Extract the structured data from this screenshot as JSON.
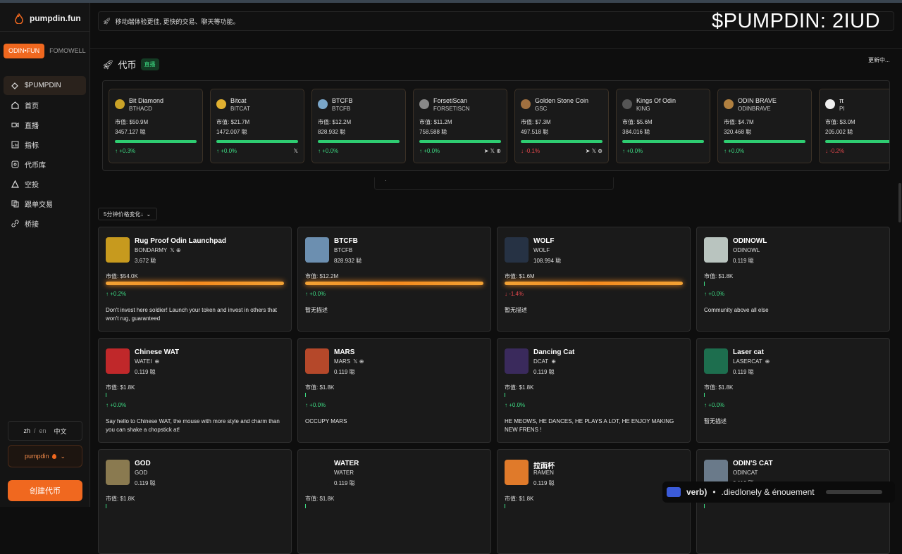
{
  "app": {
    "name": "pumpdin.fun"
  },
  "watermark": "$PUMPDIN: 2IUD",
  "banner": {
    "text": "移动端体验更佳, 更快的交易、聊天等功能。"
  },
  "platforms": [
    "ODIN•FUN",
    "FOMOWELL"
  ],
  "nav": [
    {
      "label": "$PUMPDIN",
      "icon": "diamond-icon"
    },
    {
      "label": "首页",
      "icon": "home-icon"
    },
    {
      "label": "直播",
      "icon": "video-icon"
    },
    {
      "label": "指标",
      "icon": "chart-icon"
    },
    {
      "label": "代币库",
      "icon": "library-icon"
    },
    {
      "label": "空投",
      "icon": "airdrop-icon"
    },
    {
      "label": "跟单交易",
      "icon": "copy-icon"
    },
    {
      "label": "桥接",
      "icon": "link-icon"
    }
  ],
  "lang": {
    "zh": "zh",
    "sep": "/",
    "en": "en",
    "native": "中文"
  },
  "account": {
    "name": "pumpdin"
  },
  "create_label": "创建代币",
  "section": {
    "title": "代币",
    "live": "直播",
    "updating": "更新中..."
  },
  "sort_label": "5分钟价格变化↓",
  "scroll_indicator": "·",
  "mini_tokens": [
    {
      "name": "Bit Diamond",
      "ticker": "BTHACD",
      "mcap": "市值: $50.9M",
      "holders": "3457.127 聪",
      "change": "↑ +0.3%",
      "dir": "up",
      "avatar": "#c9a227",
      "socials": ""
    },
    {
      "name": "Bitcat",
      "ticker": "BITCAT",
      "mcap": "市值: $21.7M",
      "holders": "1472.007 聪",
      "change": "↑ +0.0%",
      "dir": "up",
      "avatar": "#e0b030",
      "socials": "𝕏"
    },
    {
      "name": "BTCFB",
      "ticker": "BTCFB",
      "mcap": "市值: $12.2M",
      "holders": "828.932 聪",
      "change": "↑ +0.0%",
      "dir": "up",
      "avatar": "#7aa6c9",
      "socials": ""
    },
    {
      "name": "ForsetiScan",
      "ticker": "FORSETISCN",
      "mcap": "市值: $11.2M",
      "holders": "758.588 聪",
      "change": "↑ +0.0%",
      "dir": "up",
      "avatar": "#888888",
      "socials": "➤ 𝕏 ⊕"
    },
    {
      "name": "Golden Stone Coin",
      "ticker": "GSC",
      "mcap": "市值: $7.3M",
      "holders": "497.518 聪",
      "change": "↓ -0.1%",
      "dir": "dn",
      "avatar": "#a07040",
      "socials": "➤ 𝕏 ⊕"
    },
    {
      "name": "Kings Of Odin",
      "ticker": "KING",
      "mcap": "市值: $5.6M",
      "holders": "384.016 聪",
      "change": "↑ +0.0%",
      "dir": "up",
      "avatar": "#555555",
      "socials": ""
    },
    {
      "name": "ODIN BRAVE",
      "ticker": "ODINBRAVE",
      "mcap": "市值: $4.7M",
      "holders": "320.468 聪",
      "change": "↑ +0.0%",
      "dir": "up",
      "avatar": "#b08040",
      "socials": ""
    },
    {
      "name": "π",
      "ticker": "PI",
      "mcap": "市值: $3.0M",
      "holders": "205.002 聪",
      "change": "↓ -0.2%",
      "dir": "dn",
      "avatar": "#eeeeee",
      "socials": ""
    }
  ],
  "cards": [
    {
      "name": "Rug Proof Odin Launchpad",
      "ticker": "BONDARMY",
      "social": "𝕏 ⊕",
      "holders": "3.672 聪",
      "mcap": "市值: $54.0K",
      "change": "↑ +0.2%",
      "dir": "up",
      "desc": "Don't invest here soldier! Launch your token and invest in others that won't rug, guaranteed",
      "img": "#c79a1e",
      "progress": 1.0
    },
    {
      "name": "BTCFB",
      "ticker": "BTCFB",
      "social": "",
      "holders": "828.932 聪",
      "mcap": "市值: $12.2M",
      "change": "↑ +0.0%",
      "dir": "up",
      "desc": "暂无描述",
      "img": "#6c8fb0",
      "progress": 1.0
    },
    {
      "name": "WOLF",
      "ticker": "WOLF",
      "social": "",
      "holders": "108.994 聪",
      "mcap": "市值: $1.6M",
      "change": "↓ -1.4%",
      "dir": "dn",
      "desc": "暂无描述",
      "img": "#263244",
      "progress": 1.0
    },
    {
      "name": "ODINOWL",
      "ticker": "ODINOWL",
      "social": "",
      "holders": "0.119 聪",
      "mcap": "市值: $1.8K",
      "change": "↑ +0.0%",
      "dir": "up",
      "desc": "Community above all else",
      "img": "#b9c4bf",
      "progress": 0.0
    },
    {
      "name": "Chinese WAT",
      "ticker": "WATEI",
      "social": "⊕",
      "holders": "0.119 聪",
      "mcap": "市值: $1.8K",
      "change": "↑ +0.0%",
      "dir": "up",
      "desc": "Say hello to Chinese WAT, the mouse with more style and charm than you can shake a chopstick at!",
      "img": "#c0282a",
      "progress": 0.0
    },
    {
      "name": "MARS",
      "ticker": "MARS",
      "social": "𝕏 ⊕",
      "holders": "0.119 聪",
      "mcap": "市值: $1.8K",
      "change": "↑ +0.0%",
      "dir": "up",
      "desc": "OCCUPY MARS",
      "img": "#b5482a",
      "progress": 0.0
    },
    {
      "name": "Dancing Cat",
      "ticker": "DCAT",
      "social": "⊕",
      "holders": "0.119 聪",
      "mcap": "市值: $1.8K",
      "change": "↑ +0.0%",
      "dir": "up",
      "desc": "HE MEOWS, HE DANCES, HE PLAYS A LOT, HE ENJOY MAKING NEW FRENS !",
      "img": "#3a2a5c",
      "progress": 0.0
    },
    {
      "name": "Laser cat",
      "ticker": "LASERCAT",
      "social": "⊕",
      "holders": "0.119 聪",
      "mcap": "市值: $1.8K",
      "change": "↑ +0.0%",
      "dir": "up",
      "desc": "暂无描述",
      "img": "#1d6e4e",
      "progress": 0.0
    },
    {
      "name": "GOD",
      "ticker": "GOD",
      "social": "",
      "holders": "0.119 聪",
      "mcap": "市值: $1.8K",
      "change": "",
      "dir": "up",
      "desc": "",
      "img": "#8a7a50",
      "progress": 0.0
    },
    {
      "name": "WATER",
      "ticker": "WATER",
      "social": "",
      "holders": "0.119 聪",
      "mcap": "市值: $1.8K",
      "change": "",
      "dir": "up",
      "desc": "",
      "img": "#1a1a1a",
      "progress": 0.0
    },
    {
      "name": "拉面杯",
      "ticker": "RAMEN",
      "social": "",
      "holders": "0.119 聪",
      "mcap": "市值: $1.8K",
      "change": "",
      "dir": "up",
      "desc": "",
      "img": "#e07a2a",
      "progress": 0.0
    },
    {
      "name": "ODIN'S CAT",
      "ticker": "ODINCAT",
      "social": "",
      "holders": "0.119 聪",
      "mcap": "",
      "change": "",
      "dir": "up",
      "desc": "",
      "img": "#6a7a8a",
      "progress": 0.0
    }
  ],
  "toast": {
    "prefix": "verb)",
    "dot": "•",
    "text": ".diedlonely & énouement",
    "progress": 0.95
  }
}
